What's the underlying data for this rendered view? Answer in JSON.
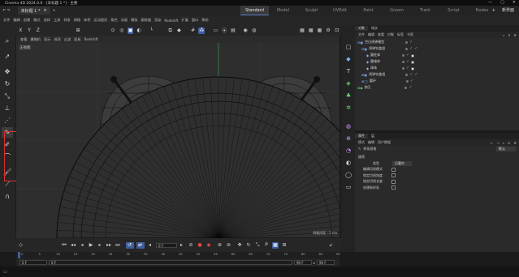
{
  "window": {
    "title": "Cinema 4D 2024.0.0 - [未标题 1 *] - 主要",
    "min": "—",
    "max": "▢",
    "close": "✕"
  },
  "top": {
    "doc_tab": "未标题 1 *",
    "layouts": [
      "Standard",
      "Model",
      "Sculpt",
      "UVEdit",
      "Paint",
      "Groom",
      "Track",
      "Script",
      "Nodes"
    ],
    "active_layout": "Standard",
    "new_layout": "新界面"
  },
  "menu": [
    "文件",
    "编辑",
    "创建",
    "模式",
    "选择",
    "工具",
    "样条",
    "网格",
    "体积",
    "运动图形",
    "角色",
    "动画",
    "模拟",
    "跟踪器",
    "渲染",
    "Redshift",
    "扩展",
    "窗口",
    "帮助"
  ],
  "viewport": {
    "menu": [
      "查看",
      "摄像机",
      "显示",
      "选项",
      "过滤",
      "面板",
      "Redshift"
    ],
    "label": "正视图",
    "grid_scale": "网格间距 : 5 cm"
  },
  "objects": {
    "tabs": [
      "对象",
      "场次"
    ],
    "menu": [
      "文件",
      "编辑",
      "查看",
      "对象",
      "标签",
      "书签"
    ],
    "rows": [
      {
        "name": "空白闹钟模型",
        "indent": 0
      },
      {
        "name": "闹钟铃盖组",
        "indent": 1
      },
      {
        "name": "圆柱体",
        "indent": 2
      },
      {
        "name": "圆锥体",
        "indent": 2
      },
      {
        "name": "球体",
        "indent": 2
      },
      {
        "name": "闹钟铃盖组",
        "indent": 1
      },
      {
        "name": "圆环",
        "indent": 1
      },
      {
        "name": "挤压",
        "indent": 0
      }
    ]
  },
  "attributes": {
    "tabs": [
      "属性",
      "层"
    ],
    "menu": [
      "模式",
      "编辑",
      "用户数据"
    ],
    "title": "样条画笔",
    "preset": "默认",
    "section": "选项",
    "type_label": "类型",
    "type_value": "贝塞尔",
    "options": [
      "编辑切线模式",
      "锁定切线角度",
      "锁定切线长度",
      "创建新样条"
    ]
  },
  "timeline": {
    "frame_field": "0 F",
    "ruler": [
      "0",
      "5",
      "10",
      "15",
      "20",
      "25",
      "30",
      "35",
      "40",
      "45",
      "50",
      "55",
      "60",
      "65",
      "70",
      "75",
      "80",
      "85",
      "90"
    ],
    "start": "0 F",
    "start2": "0 F",
    "end": "90 F",
    "end2": "90 F"
  },
  "colors": {
    "accent": "#3f5e9e",
    "highlight_box": "#d9322c",
    "green_axis": "#3fa84a",
    "wire": "#0a0a0a"
  }
}
